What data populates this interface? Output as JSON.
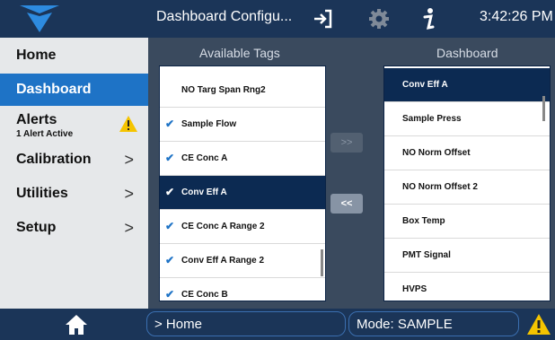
{
  "header": {
    "title": "Dashboard Configu...",
    "clock": "3:42:26 PM"
  },
  "sidebar": {
    "items": [
      {
        "label": "Home"
      },
      {
        "label": "Dashboard"
      },
      {
        "label": "Alerts",
        "sub": "1 Alert Active"
      },
      {
        "label": "Calibration",
        "chevron": ">"
      },
      {
        "label": "Utilities",
        "chevron": ">"
      },
      {
        "label": "Setup",
        "chevron": ">"
      }
    ]
  },
  "available": {
    "header": "Available Tags",
    "items": [
      {
        "label": "NO Targ Span Rng2",
        "checked": false
      },
      {
        "label": "Sample Flow",
        "checked": true
      },
      {
        "label": "CE Conc A",
        "checked": true
      },
      {
        "label": "Conv Eff A",
        "checked": true,
        "selected": true
      },
      {
        "label": "CE Conc A Range 2",
        "checked": true
      },
      {
        "label": "Conv Eff A Range 2",
        "checked": true
      },
      {
        "label": "CE Conc B",
        "checked": true
      }
    ]
  },
  "dashboard_list": {
    "header": "Dashboard",
    "items": [
      {
        "label": "Conv Eff A",
        "selected": true
      },
      {
        "label": "Sample Press"
      },
      {
        "label": "NO Norm Offset"
      },
      {
        "label": "NO Norm Offset 2"
      },
      {
        "label": "Box Temp"
      },
      {
        "label": "PMT Signal"
      },
      {
        "label": "HVPS"
      }
    ]
  },
  "buttons": {
    "add": ">>",
    "remove": "<<"
  },
  "footer": {
    "path": "> Home",
    "mode": "Mode: SAMPLE"
  },
  "colors": {
    "header_bg": "#1b3558",
    "active_nav": "#1e73c6",
    "selected_row": "#0c2a52",
    "warning": "#f5c400"
  },
  "icons": [
    "teledyne-logo-icon",
    "sign-in-icon",
    "gear-icon",
    "info-icon",
    "warning-icon",
    "home-icon",
    "check-icon"
  ]
}
